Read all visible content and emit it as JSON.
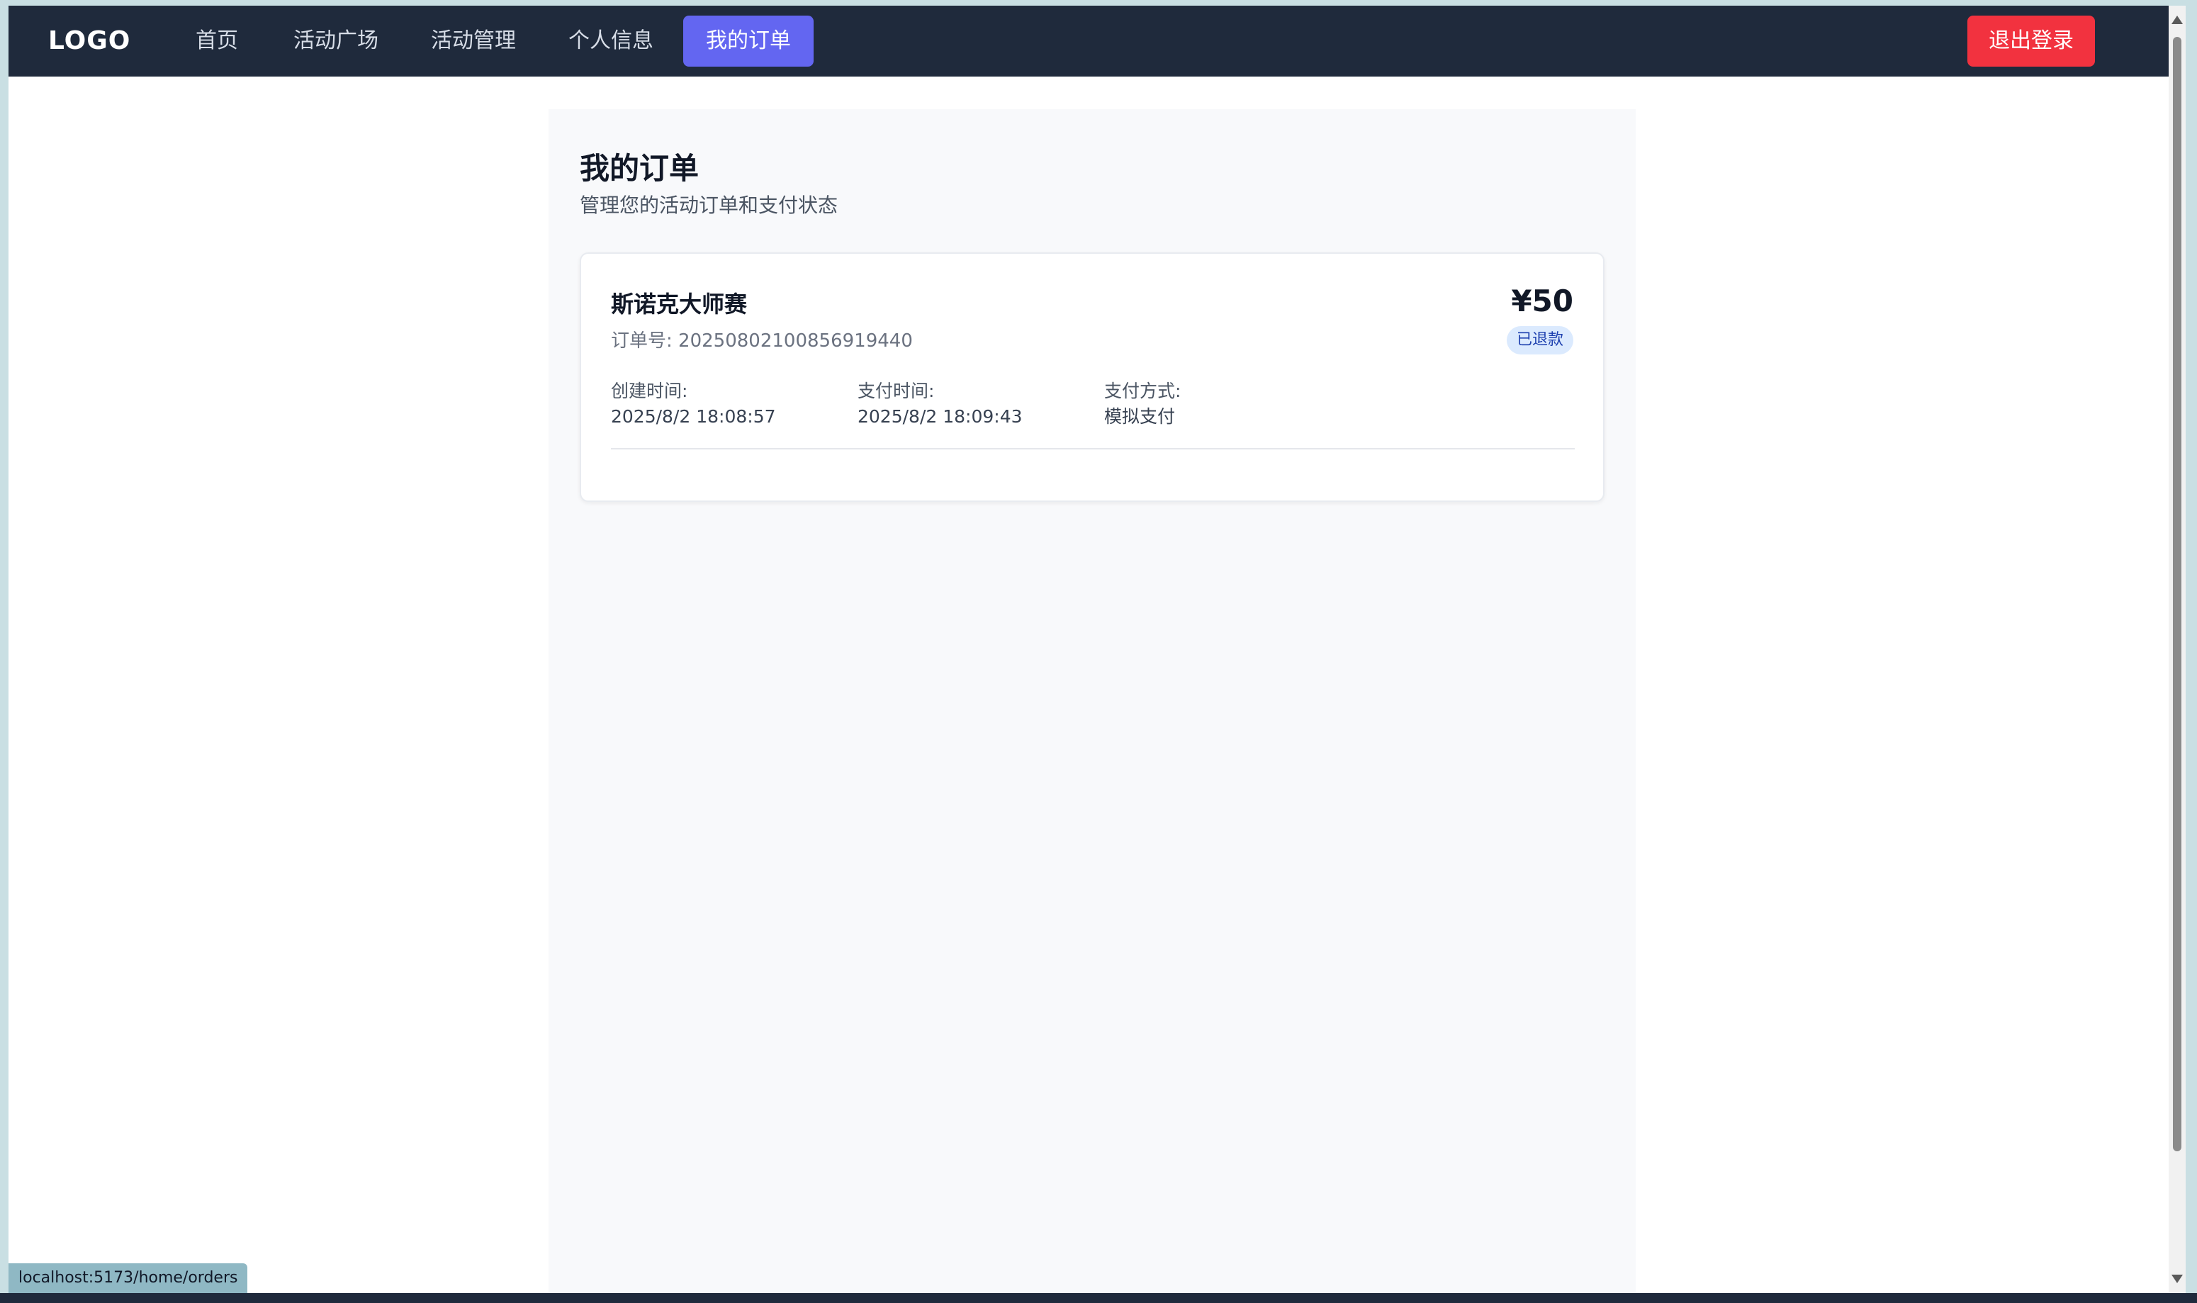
{
  "nav": {
    "logo": "LOGO",
    "items": [
      {
        "label": "首页"
      },
      {
        "label": "活动广场"
      },
      {
        "label": "活动管理"
      },
      {
        "label": "个人信息"
      },
      {
        "label": "我的订单",
        "active": true
      }
    ],
    "logout_label": "退出登录"
  },
  "page": {
    "title": "我的订单",
    "subtitle": "管理您的活动订单和支付状态"
  },
  "orders": [
    {
      "name": "斯诺克大师赛",
      "order_no_label": "订单号: 20250802100856919440",
      "price": "¥50",
      "status": "已退款",
      "created_label": "创建时间:",
      "created_value": "2025/8/2 18:08:57",
      "paid_label": "支付时间:",
      "paid_value": "2025/8/2 18:09:43",
      "method_label": "支付方式:",
      "method_value": "模拟支付"
    }
  ],
  "statusbar": {
    "url": "localhost:5173/home/orders"
  },
  "colors": {
    "nav_bg": "#1f2a3c",
    "active_tab": "#6366f1",
    "logout": "#f2323f",
    "status_badge_bg": "#dbeafe",
    "status_badge_text": "#1e40af"
  }
}
